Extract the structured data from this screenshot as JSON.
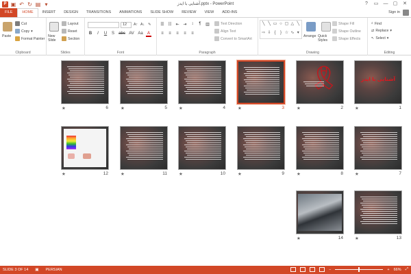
{
  "window": {
    "title": "آشنایی با ایدز.pptx - PowerPoint",
    "app_icon_letter": "P",
    "signin": "Sign in",
    "controls": [
      "?",
      "▭",
      "—",
      "▢",
      "✕"
    ]
  },
  "tabs": [
    "FILE",
    "HOME",
    "INSERT",
    "DESIGN",
    "TRANSITIONS",
    "ANIMATIONS",
    "SLIDE SHOW",
    "REVIEW",
    "VIEW",
    "ADD-INS"
  ],
  "ribbon": {
    "clipboard": {
      "label": "Clipboard",
      "paste": "Paste",
      "cut": "Cut",
      "copy": "Copy",
      "format_painter": "Format Painter"
    },
    "slides": {
      "label": "Slides",
      "new_slide": "New Slide",
      "layout": "Layout",
      "reset": "Reset",
      "section": "Section"
    },
    "font": {
      "label": "Font",
      "size": "12",
      "row2": [
        "B",
        "I",
        "U",
        "S",
        "abc",
        "AV",
        "Aa",
        "A"
      ]
    },
    "paragraph": {
      "label": "Paragraph",
      "text_direction": "Text Direction",
      "align_text": "Align Text",
      "convert": "Convert to SmartArt"
    },
    "drawing": {
      "label": "Drawing",
      "arrange": "Arrange",
      "quick_styles": "Quick Styles",
      "shape_fill": "Shape Fill",
      "shape_outline": "Shape Outline",
      "shape_effects": "Shape Effects"
    },
    "editing": {
      "label": "Editing",
      "find": "Find",
      "replace": "Replace",
      "select": "Select"
    }
  },
  "slides": [
    {
      "n": "1",
      "kind": "title",
      "title": "آشنایی با ایدز"
    },
    {
      "n": "2",
      "kind": "ribbon"
    },
    {
      "n": "3",
      "kind": "text",
      "selected": true
    },
    {
      "n": "4",
      "kind": "text"
    },
    {
      "n": "5",
      "kind": "text"
    },
    {
      "n": "6",
      "kind": "text"
    },
    {
      "n": "7",
      "kind": "text"
    },
    {
      "n": "8",
      "kind": "text"
    },
    {
      "n": "9",
      "kind": "text"
    },
    {
      "n": "10",
      "kind": "text"
    },
    {
      "n": "11",
      "kind": "text"
    },
    {
      "n": "12",
      "kind": "diagram"
    },
    {
      "n": "13",
      "kind": "text"
    },
    {
      "n": "14",
      "kind": "photo"
    }
  ],
  "status": {
    "slide_info": "SLIDE 3 OF 14",
    "language": "PERSIAN",
    "zoom": "66%"
  },
  "colors": {
    "accent": "#d24726"
  }
}
